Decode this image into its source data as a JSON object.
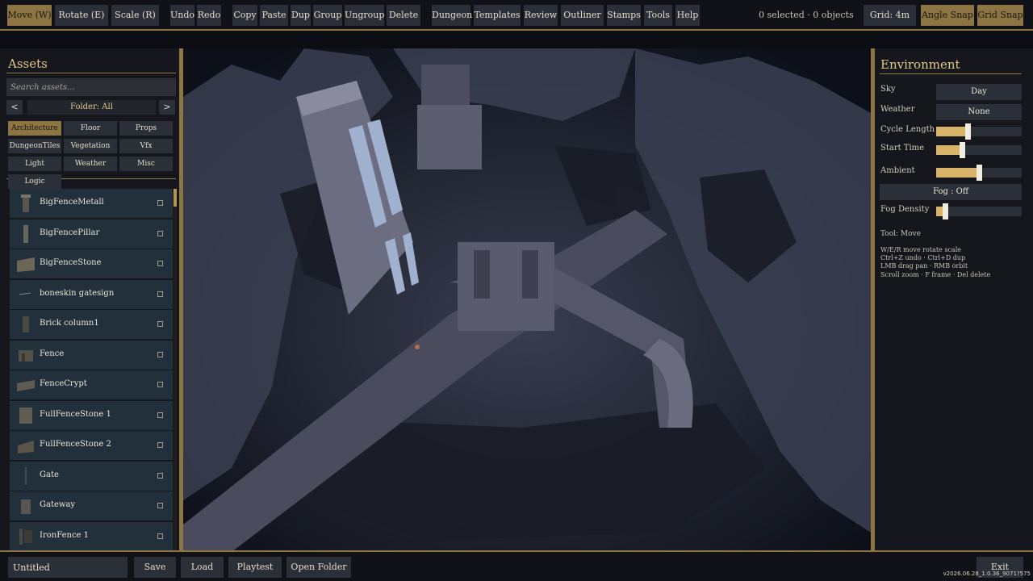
{
  "toolbar": {
    "move": "Move (W)",
    "rotate": "Rotate (E)",
    "scale": "Scale (R)",
    "undo": "Undo",
    "redo": "Redo",
    "copy": "Copy",
    "paste": "Paste",
    "dup": "Dup",
    "group": "Group",
    "ungroup": "Ungroup",
    "delete": "Delete",
    "dungeon": "Dungeon",
    "templates": "Templates",
    "review": "Review",
    "outliner": "Outliner",
    "stamps": "Stamps",
    "tools": "Tools",
    "help": "Help",
    "selection_status": "0 selected · 0 objects",
    "grid": "Grid: 4m",
    "angle_snap": "Angle Snap",
    "grid_snap": "Grid Snap"
  },
  "assets": {
    "title": "Assets",
    "search_placeholder": "Search assets...",
    "prev": "<",
    "next": ">",
    "folder": "Folder: All",
    "categories": [
      "Architecture",
      "Floor",
      "Props",
      "DungeonTiles",
      "Vegetation",
      "Vfx",
      "Light",
      "Weather",
      "Misc",
      "Logic"
    ],
    "active_category": "Architecture",
    "items": [
      "BigFenceMetall",
      "BigFencePillar",
      "BigFenceStone",
      "boneskin gatesign",
      "Brick column1",
      "Fence",
      "FenceCrypt",
      "FullFenceStone 1",
      "FullFenceStone 2",
      "Gate",
      "Gateway",
      "IronFence 1"
    ]
  },
  "environment": {
    "title": "Environment",
    "sky_label": "Sky",
    "sky_value": "Day",
    "weather_label": "Weather",
    "weather_value": "None",
    "cycle_label": "Cycle Length",
    "cycle_fraction": 0.37,
    "start_label": "Start Time",
    "start_fraction": 0.3,
    "ambient_label": "Ambient",
    "ambient_fraction": 0.5,
    "fog_toggle": "Fog : Off",
    "fog_density_label": "Fog Density",
    "fog_density_fraction": 0.1,
    "tool_status": "Tool: Move",
    "help": [
      "W/E/R move rotate scale",
      "Ctrl+Z undo · Ctrl+D dup",
      "LMB drag pan · RMB orbit",
      "Scroll zoom · F frame · Del delete"
    ]
  },
  "bottom": {
    "file_name": "Untitled",
    "save": "Save",
    "load": "Load",
    "playtest": "Playtest",
    "open_folder": "Open Folder",
    "exit": "Exit",
    "version": "v2026.06.28_1.0.36_9071?575"
  },
  "colors": {
    "accent_gold": "#8c7443",
    "title_gold": "#e3c887",
    "button": "#2b2f38",
    "panel": "#15171d",
    "list_item": "#22303c"
  }
}
